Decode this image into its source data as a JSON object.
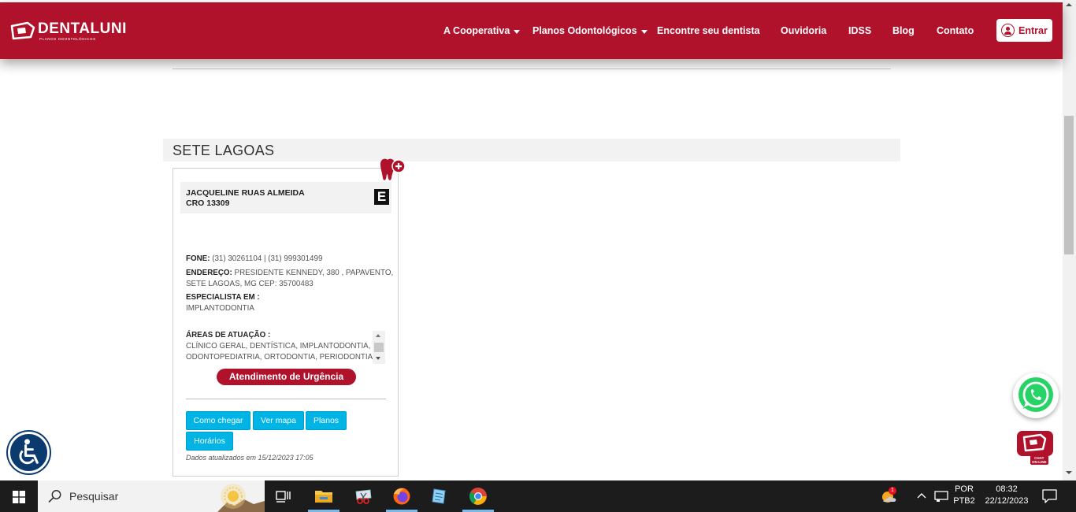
{
  "header": {
    "brand": "DENTALUNI",
    "brand_sub": "PLANOS ODONTOLÓGICOS",
    "brand_color": "#b0112b",
    "nav": [
      {
        "label": "A Cooperativa",
        "has_dropdown": true
      },
      {
        "label": "Planos Odontológicos",
        "has_dropdown": true
      },
      {
        "label": "Encontre seu dentista",
        "has_dropdown": false
      },
      {
        "label": "Ouvidoria",
        "has_dropdown": false
      },
      {
        "label": "IDSS",
        "has_dropdown": false
      },
      {
        "label": "Blog",
        "has_dropdown": false
      },
      {
        "label": "Contato",
        "has_dropdown": false
      }
    ],
    "login_label": "Entrar",
    "login_icon": "user-circle-icon"
  },
  "city": "SETE LAGOAS",
  "card": {
    "name": "JACQUELINE RUAS ALMEIDA",
    "cro": "CRO 13309",
    "badge_letter": "E",
    "phone_label": "FONE:",
    "phone_value": "(31) 30261104 | (31) 999301499",
    "address_label": "ENDEREÇO:",
    "address_line1": "PRESIDENTE KENNEDY, 380 , PAPAVENTO,",
    "address_line2": "SETE LAGOAS, MG CEP: 35700483",
    "specialist_label": "ESPECIALISTA EM :",
    "specialist_value": "IMPLANTODONTIA",
    "areas_label": "ÁREAS DE ATUAÇÃO :",
    "areas_line1": "CLÍNICO GERAL, DENTÍSTICA, IMPLANTODONTIA,",
    "areas_line2": "ODONTOPEDIATRIA, ORTODONTIA, PERIODONTIA,",
    "urgent_label": "Atendimento de Urgência",
    "buttons": {
      "directions": "Como chegar",
      "map": "Ver mapa",
      "plans": "Planos",
      "hours": "Horários"
    },
    "updated": "Dados atualizados em 15/12/2023 17:05",
    "accent_button_color": "#00b4e6"
  },
  "floating": {
    "chat_label_1": "CHAT",
    "chat_label_2": "ON-LINE"
  },
  "taskbar": {
    "search_placeholder": "Pesquisar",
    "lang_line1": "POR",
    "lang_line2": "PTB2",
    "time": "08:32",
    "date": "22/12/2023",
    "weather_badge": "1"
  }
}
